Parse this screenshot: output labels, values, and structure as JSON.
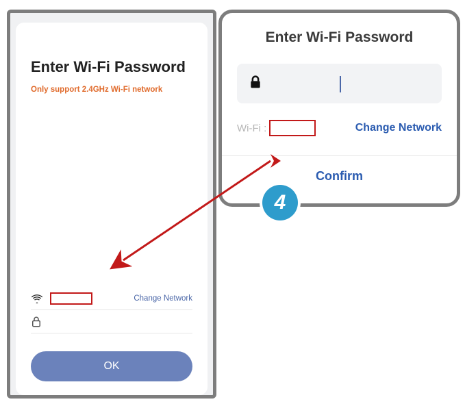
{
  "left": {
    "title": "Enter Wi-Fi Password",
    "subtitle": "Only support 2.4GHz Wi-Fi network",
    "change_network": "Change Network",
    "ok_label": "OK"
  },
  "right": {
    "title": "Enter Wi-Fi Password",
    "wifi_label": "Wi-Fi :",
    "change_network": "Change Network",
    "confirm_label": "Confirm",
    "password_value": ""
  },
  "annotation": {
    "step_number": "4"
  }
}
